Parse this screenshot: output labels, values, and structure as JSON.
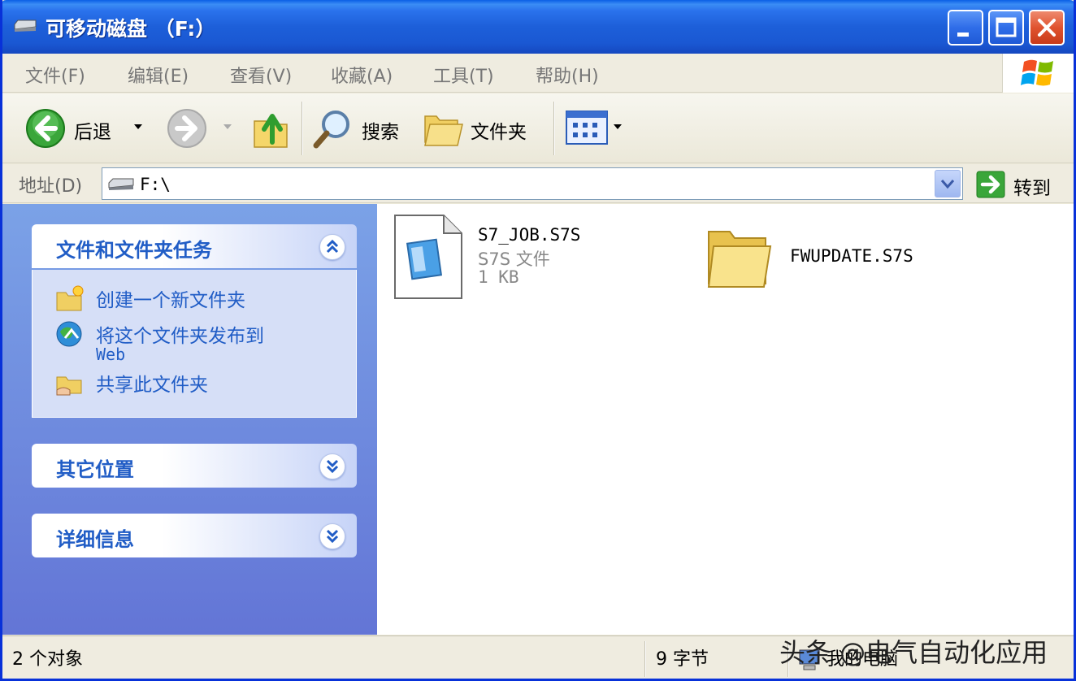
{
  "window": {
    "title": "可移动磁盘 （F:）",
    "controls": {
      "minimize": "_",
      "maximize": "□",
      "close": "✕"
    }
  },
  "menu": [
    "文件(F)",
    "编辑(E)",
    "查看(V)",
    "收藏(A)",
    "工具(T)",
    "帮助(H)"
  ],
  "toolbar": {
    "back_label": "后退",
    "search_label": "搜索",
    "folders_label": "文件夹"
  },
  "address": {
    "label": "地址(D)",
    "value": "F:\\",
    "go_label": "转到"
  },
  "taskpane": {
    "file_tasks": {
      "title": "文件和文件夹任务",
      "items": [
        "创建一个新文件夹",
        "将这个文件夹发布到",
        "Web",
        "共享此文件夹"
      ]
    },
    "other_places": {
      "title": "其它位置"
    },
    "details": {
      "title": "详细信息"
    }
  },
  "files": [
    {
      "name": "S7_JOB.S7S",
      "type": "S7S 文件",
      "size": "1 KB",
      "icon": "s7s-file-icon"
    },
    {
      "name": "FWUPDATE.S7S",
      "icon": "folder-icon"
    }
  ],
  "status": {
    "objects": "2 个对象",
    "bytes": "9 字节",
    "location": "我的电脑"
  },
  "watermark": "头条 @电气自动化应用",
  "colors": {
    "title_bar": "#1d5fd9",
    "task_link": "#215dc6",
    "task_pane": "#6f8fe0"
  }
}
